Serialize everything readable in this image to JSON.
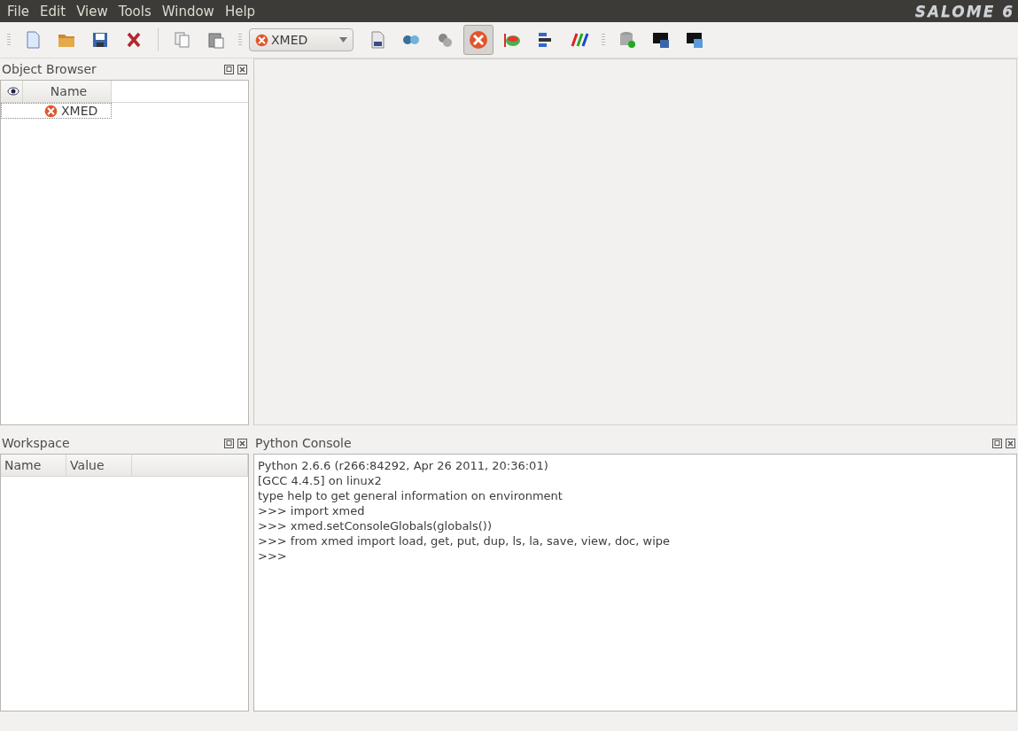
{
  "menu": [
    "File",
    "Edit",
    "View",
    "Tools",
    "Window",
    "Help"
  ],
  "logo": "SALOME 6",
  "toolbar": {
    "file_buttons": [
      {
        "selected": false
      },
      {
        "selected": false
      },
      {
        "selected": false
      },
      {
        "selected": false
      }
    ],
    "edit_buttons": [
      {
        "selected": false
      },
      {
        "selected": false
      }
    ],
    "module_combo": {
      "value": "XMED"
    },
    "module_buttons": [
      {
        "selected": false
      },
      {
        "selected": false
      },
      {
        "selected": false
      },
      {
        "selected": true
      },
      {
        "selected": false
      },
      {
        "selected": false
      },
      {
        "selected": false
      }
    ],
    "extra_buttons": [
      {
        "selected": false
      },
      {
        "selected": false
      },
      {
        "selected": false
      }
    ]
  },
  "object_browser": {
    "title": "Object Browser",
    "columns": [
      "Name"
    ],
    "rows": [
      {
        "name": "XMED",
        "selected": true
      }
    ]
  },
  "workspace": {
    "title": "Workspace",
    "columns": [
      "Name",
      "Value"
    ]
  },
  "python_console": {
    "title": "Python Console",
    "lines": [
      "Python 2.6.6 (r266:84292, Apr 26 2011, 20:36:01)",
      "[GCC 4.4.5] on linux2",
      "type help to get general information on environment",
      ">>> import xmed",
      ">>> xmed.setConsoleGlobals(globals())",
      ">>> from xmed import load, get, put, dup, ls, la, save, view, doc, wipe",
      ">>>"
    ]
  }
}
